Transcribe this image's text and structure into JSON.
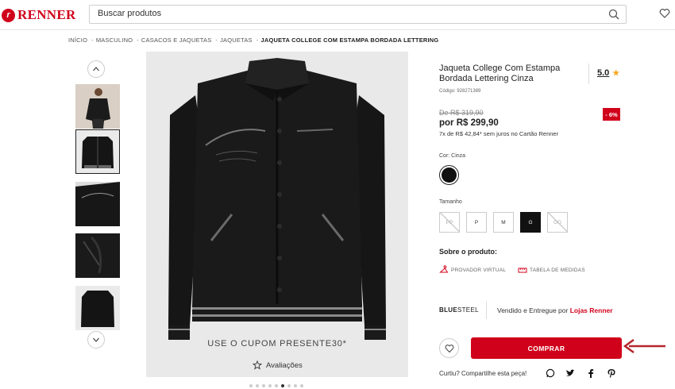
{
  "header": {
    "logo_text": "RENNER",
    "logo_mark": "r",
    "search_placeholder": "Buscar produtos"
  },
  "breadcrumb": {
    "items": [
      "INÍCIO",
      "MASCULINO",
      "CASACOS E JAQUETAS",
      "JAQUETAS"
    ],
    "separator": "-",
    "current": "JAQUETA COLLEGE COM ESTAMPA BORDADA LETTERING"
  },
  "gallery": {
    "thumbnail_count": 5,
    "selected_index": 1,
    "coupon_text": "USE O CUPOM PRESENTE30*",
    "reviews_label": "Avaliações",
    "dot_count": 9,
    "active_dot": 5
  },
  "product": {
    "title": "Jaqueta College Com Estampa Bordada Lettering Cinza",
    "rating": "5.0",
    "code": "Código: 928271389",
    "old_price": "De R$ 319,90",
    "discount": "- 6%",
    "price": "por R$ 299,90",
    "installments": "7x de R$ 42,84* sem juros no Cartão Renner",
    "color_label": "Cor: Cinza",
    "size_label": "Tamanho",
    "sizes": [
      {
        "label": "PP",
        "state": "unavailable"
      },
      {
        "label": "P",
        "state": "available"
      },
      {
        "label": "M",
        "state": "available"
      },
      {
        "label": "G",
        "state": "selected"
      },
      {
        "label": "GG",
        "state": "unavailable"
      }
    ],
    "about_title": "Sobre o produto:",
    "virtual_fitting": "PROVADOR VIRTUAL",
    "size_chart": "TABELA DE MEDIDAS",
    "brand_bold": "BLUE",
    "brand_rest": "STEEL",
    "sold_by": "Vendido e Entregue por",
    "store": "Lojas Renner",
    "buy_label": "COMPRAR",
    "share_text": "Curtiu? Compartilhe esta peça!",
    "share_icons": [
      "whatsapp-icon",
      "twitter-icon",
      "facebook-icon",
      "pinterest-icon"
    ]
  },
  "colors": {
    "brand_red": "#d0021b",
    "star": "#f5a623"
  }
}
